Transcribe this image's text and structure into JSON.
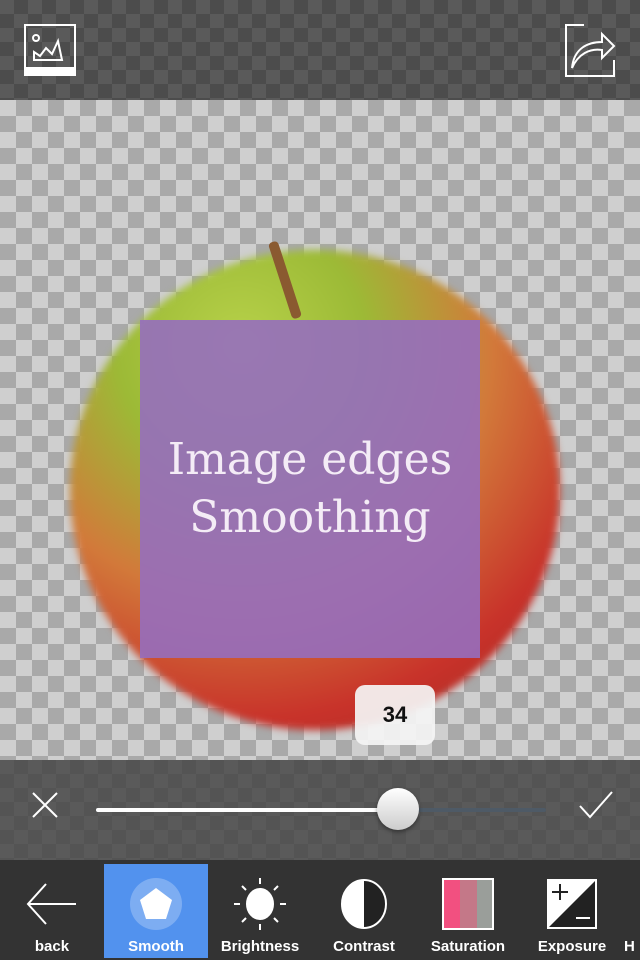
{
  "header": {
    "left_icon": "gallery-image-icon",
    "right_icon": "share-icon"
  },
  "canvas": {
    "overlay_line1": "Image edges",
    "overlay_line2": "Smoothing",
    "value_badge": "34"
  },
  "slider": {
    "value": 34,
    "level_fraction": 0.67,
    "cancel_icon": "close-icon",
    "confirm_icon": "checkmark-icon"
  },
  "toolbar": {
    "items": [
      {
        "label": "back",
        "icon": "arrow-left-icon"
      },
      {
        "label": "Smooth",
        "icon": "pentagon-icon",
        "active": true
      },
      {
        "label": "Brightness",
        "icon": "sun-icon"
      },
      {
        "label": "Contrast",
        "icon": "contrast-icon"
      },
      {
        "label": "Saturation",
        "icon": "saturation-icon"
      },
      {
        "label": "Exposure",
        "icon": "exposure-icon"
      },
      {
        "label": "H",
        "icon": ""
      }
    ]
  },
  "colors": {
    "accent": "#5292ee",
    "overlay": "#966ebe"
  }
}
